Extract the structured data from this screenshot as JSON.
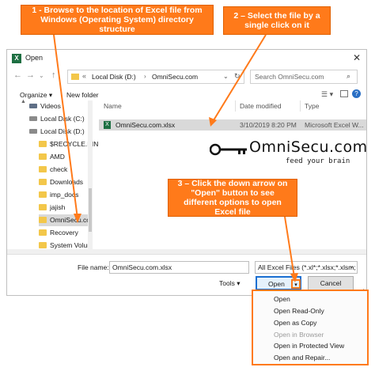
{
  "callouts": {
    "c1": "1 - Browse to the location of Excel file from Windows (Operating System) directory structure",
    "c2": "2 – Select the file by a single click on it",
    "c3": "3 – Click the down arrow on \"Open\" button to see different options to open Excel file"
  },
  "window": {
    "title": "Open",
    "address_prefix": "«",
    "address_parts": [
      "Local Disk (D:)",
      "OmniSecu.com"
    ],
    "search_placeholder": "Search OmniSecu.com"
  },
  "toolbar": {
    "organize": "Organize ▾",
    "new_folder": "New folder"
  },
  "sidebar": {
    "items": [
      {
        "label": "Videos",
        "icon": "video-icon"
      },
      {
        "label": "Local Disk (C:)",
        "icon": "drive-icon"
      },
      {
        "label": "Local Disk (D:)",
        "icon": "drive-icon"
      },
      {
        "label": "$RECYCLE.BIN",
        "icon": "folder-icon"
      },
      {
        "label": "AMD",
        "icon": "folder-icon"
      },
      {
        "label": "check",
        "icon": "folder-icon"
      },
      {
        "label": "Downloads",
        "icon": "folder-icon"
      },
      {
        "label": "imp_docs",
        "icon": "folder-icon"
      },
      {
        "label": "jajish",
        "icon": "folder-icon"
      },
      {
        "label": "OmniSecu.com",
        "icon": "folder-icon"
      },
      {
        "label": "Recovery",
        "icon": "folder-icon"
      },
      {
        "label": "System Volume",
        "icon": "folder-icon"
      }
    ]
  },
  "columns": {
    "name": "Name",
    "date": "Date modified",
    "type": "Type"
  },
  "files": [
    {
      "name": "OmniSecu.com.xlsx",
      "date": "3/10/2019 8:20 PM",
      "type": "Microsoft Excel W..."
    }
  ],
  "logo": {
    "name": "OmniSecu.com",
    "tagline": "feed your brain"
  },
  "bottom": {
    "file_name_label": "File name:",
    "file_name_value": "OmniSecu.com.xlsx",
    "filter": "All Excel Files (*.xl*;*.xlsx;*.xlsm;",
    "tools": "Tools ▾",
    "open": "Open",
    "cancel": "Cancel"
  },
  "open_menu": [
    "Open",
    "Open Read-Only",
    "Open as Copy",
    "Open in Browser",
    "Open in Protected View",
    "Open and Repair..."
  ],
  "colors": {
    "accent": "#ff7a1a",
    "excel": "#1d6f42"
  }
}
